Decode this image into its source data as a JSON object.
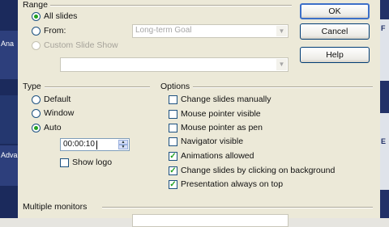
{
  "background": {
    "left_texts": [
      "Ana",
      "Adva"
    ],
    "right_texts": [
      "F",
      "E"
    ]
  },
  "range": {
    "heading": "Range",
    "all_slides_label": "All slides",
    "from_label": "From:",
    "from_value": "Long-term Goal",
    "custom_label": "Custom Slide Show",
    "custom_value": "",
    "selected": "all_slides"
  },
  "buttons": {
    "ok": "OK",
    "cancel": "Cancel",
    "help": "Help"
  },
  "type": {
    "heading": "Type",
    "default_label": "Default",
    "window_label": "Window",
    "auto_label": "Auto",
    "selected": "auto",
    "pause_value": "00:00:10",
    "show_logo_label": "Show logo",
    "show_logo_checked": false
  },
  "options": {
    "heading": "Options",
    "items": [
      {
        "label": "Change slides manually",
        "checked": false
      },
      {
        "label": "Mouse pointer visible",
        "checked": false
      },
      {
        "label": "Mouse pointer as pen",
        "checked": false
      },
      {
        "label": "Navigator visible",
        "checked": false
      },
      {
        "label": "Animations allowed",
        "checked": true
      },
      {
        "label": "Change slides by clicking on background",
        "checked": true
      },
      {
        "label": "Presentation always on top",
        "checked": true
      }
    ]
  },
  "monitors": {
    "heading": "Multiple monitors"
  },
  "colors": {
    "accent_green": "#21a121",
    "default_button_border": "#3c6fc8",
    "dialog_bg": "#ece9d8"
  },
  "icons": {
    "dropdown": "chevron-down-icon",
    "spin_up": "spin-up-icon",
    "spin_down": "spin-down-icon",
    "check": "check-icon"
  }
}
